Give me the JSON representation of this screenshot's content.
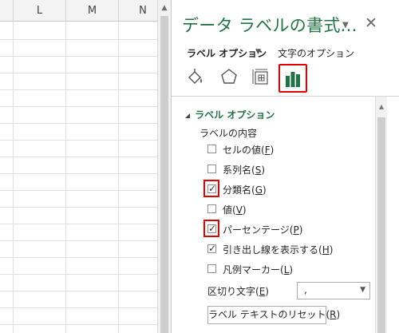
{
  "spreadsheet": {
    "columns": [
      "L",
      "M",
      "N"
    ]
  },
  "pane": {
    "title": "データ ラベルの書式...",
    "dropdown_icon": "chevron-down-icon",
    "close_icon": "close-icon",
    "tabs": {
      "label_options": "ラベル オプション",
      "text_options": "文字のオプション"
    },
    "icons": [
      "fill-line-icon",
      "effects-pentagon-icon",
      "size-properties-icon",
      "bar-chart-icon"
    ],
    "section_header": "ラベル オプション",
    "label_contains_header": "ラベルの内容",
    "checkboxes": [
      {
        "label": "セルの値",
        "key": "F",
        "checked": false
      },
      {
        "label": "系列名",
        "key": "S",
        "checked": false
      },
      {
        "label": "分類名",
        "key": "G",
        "checked": true
      },
      {
        "label": "値",
        "key": "V",
        "checked": false
      },
      {
        "label": "パーセンテージ",
        "key": "P",
        "checked": true
      },
      {
        "label": "引き出し線を表示する",
        "key": "H",
        "checked": true
      },
      {
        "label": "凡例マーカー",
        "key": "L",
        "checked": false
      }
    ],
    "separator": {
      "label": "区切り文字",
      "key": "E",
      "value": ","
    },
    "reset_button": {
      "label": "ラベル テキストのリセット",
      "key": "R"
    }
  },
  "colors": {
    "accent_green": "#217346",
    "highlight_red": "#e00000"
  }
}
